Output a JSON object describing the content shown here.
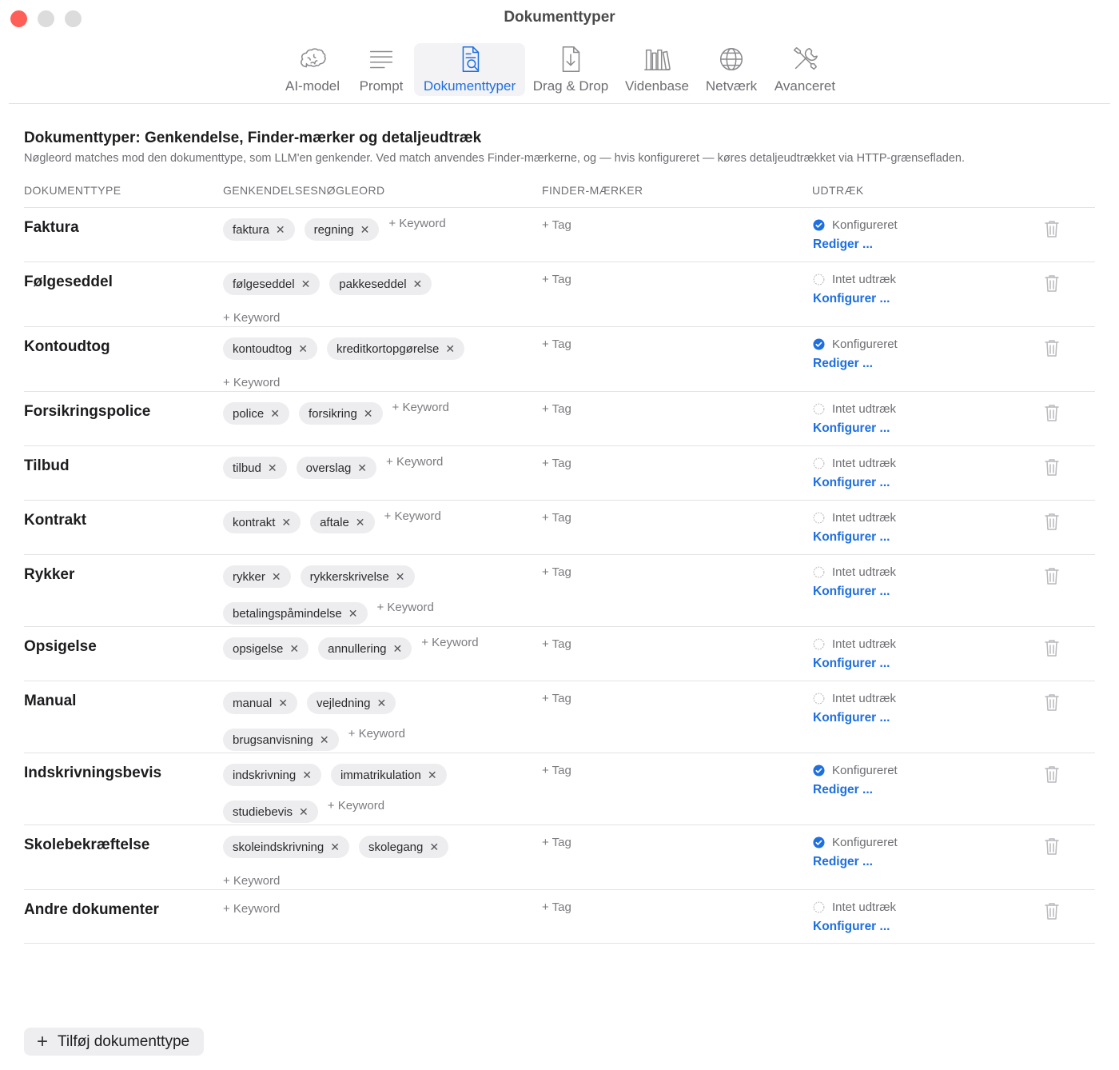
{
  "window": {
    "title": "Dokumenttyper"
  },
  "toolbar": {
    "items": [
      {
        "label": "AI-model",
        "icon": "brain-icon"
      },
      {
        "label": "Prompt",
        "icon": "text-lines-icon"
      },
      {
        "label": "Dokumenttyper",
        "icon": "document-search-icon",
        "active": true
      },
      {
        "label": "Drag & Drop",
        "icon": "document-download-icon"
      },
      {
        "label": "Videnbase",
        "icon": "books-icon"
      },
      {
        "label": "Netværk",
        "icon": "globe-icon"
      },
      {
        "label": "Avanceret",
        "icon": "tools-icon"
      }
    ]
  },
  "header": {
    "title": "Dokumenttyper: Genkendelse, Finder-mærker og detaljeudtræk",
    "subtitle": "Nøgleord matches mod den dokumenttype, som LLM'en genkender. Ved match anvendes Finder-mærkerne, og — hvis konfigureret — køres detaljeudtrækket via HTTP-grænsefladen."
  },
  "columns": {
    "doctype": "DOKUMENTTYPE",
    "keywords": "GENKENDELSESNØGLEORD",
    "tags": "FINDER-MÆRKER",
    "extract": "UDTRÆK"
  },
  "labels": {
    "add_keyword": "+ Keyword",
    "add_tag": "+ Tag",
    "configured": "Konfigureret",
    "not_configured": "Intet udtræk",
    "edit": "Rediger ...",
    "configure": "Konfigurer ...",
    "remove_glyph": "✕"
  },
  "colors": {
    "accent": "#1e6fe0",
    "close": "#fe5f57"
  },
  "rows": [
    {
      "name": "Faktura",
      "keywords": [
        "faktura",
        "regning"
      ],
      "configured": true
    },
    {
      "name": "Følgeseddel",
      "keywords": [
        "følgeseddel",
        "pakkeseddel"
      ],
      "configured": false
    },
    {
      "name": "Kontoudtog",
      "keywords": [
        "kontoudtog",
        "kreditkortopgørelse"
      ],
      "configured": true
    },
    {
      "name": "Forsikringspolice",
      "keywords": [
        "police",
        "forsikring"
      ],
      "configured": false
    },
    {
      "name": "Tilbud",
      "keywords": [
        "tilbud",
        "overslag"
      ],
      "configured": false
    },
    {
      "name": "Kontrakt",
      "keywords": [
        "kontrakt",
        "aftale"
      ],
      "configured": false
    },
    {
      "name": "Rykker",
      "keywords": [
        "rykker",
        "rykkerskrivelse",
        "betalingspåmindelse"
      ],
      "configured": false
    },
    {
      "name": "Opsigelse",
      "keywords": [
        "opsigelse",
        "annullering"
      ],
      "configured": false
    },
    {
      "name": "Manual",
      "keywords": [
        "manual",
        "vejledning",
        "brugsanvisning"
      ],
      "configured": false
    },
    {
      "name": "Indskrivningsbevis",
      "keywords": [
        "indskrivning",
        "immatrikulation",
        "studiebevis"
      ],
      "configured": true
    },
    {
      "name": "Skolebekræftelse",
      "keywords": [
        "skoleindskrivning",
        "skolegang"
      ],
      "configured": true
    },
    {
      "name": "Andre dokumenter",
      "keywords": [],
      "configured": false
    }
  ],
  "footer": {
    "add_button": "Tilføj dokumenttype"
  }
}
